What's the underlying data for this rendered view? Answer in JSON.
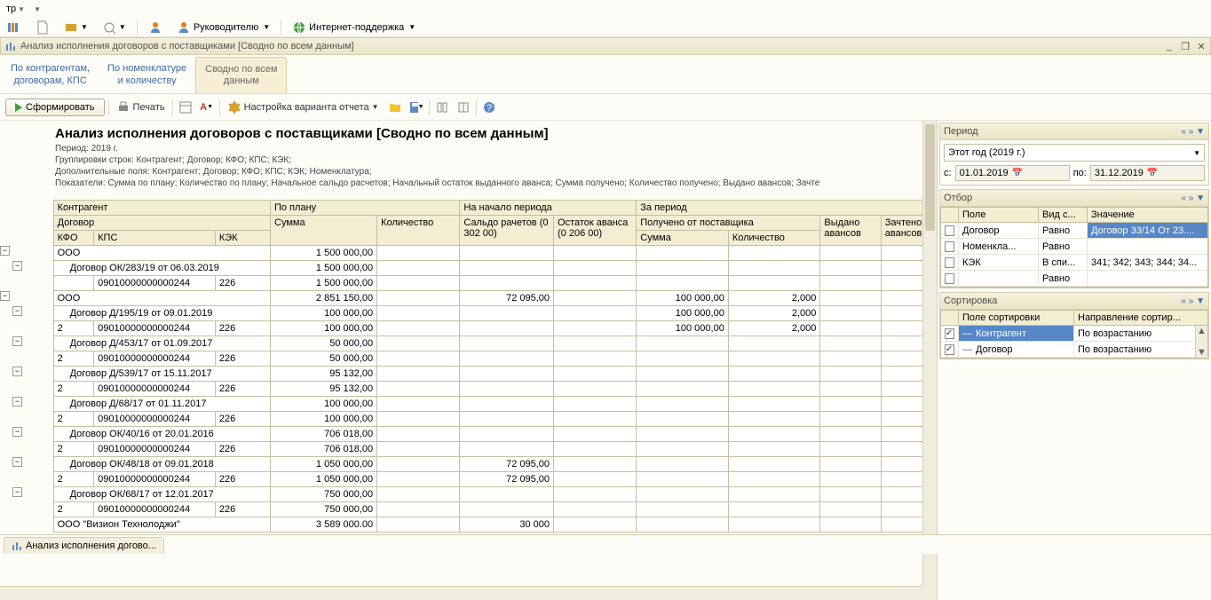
{
  "topbar": {
    "rukov": "Руководителю",
    "inet": "Интернет-поддержка"
  },
  "window": {
    "title": "Анализ исполнения договоров с поставщиками [Сводно по всем данным]"
  },
  "main_tabs": [
    {
      "label": "По контрагентам,\nдоговорам, КПС"
    },
    {
      "label": "По номенклатуре\nи количеству"
    },
    {
      "label": "Сводно по всем\nданным"
    }
  ],
  "report_tb": {
    "form": "Сформировать",
    "print": "Печать",
    "settings": "Настройка варианта отчета"
  },
  "report_header": {
    "title": "Анализ исполнения договоров с поставщиками [Сводно по всем данным]",
    "m1": "Период: 2019 г.",
    "m2": "Группировки строк: Контрагент; Договор; КФО; КПС; КЭК;",
    "m3": "Дополнительные поля: Контрагент; Договор; КФО; КПС; КЭК; Номенклатура;",
    "m4": "Показатели: Сумма по плану; Количество по плану; Начальное сальдо расчетов; Начальный остаток выданного аванса; Сумма получено; Количество получено; Выдано авансов; Зачте"
  },
  "cols": {
    "c1": "Контрагент",
    "c2": "По плану",
    "c3": "На начало периода",
    "c4": "За период",
    "d1": "Договор",
    "d2": "Сумма",
    "d3": "Количество",
    "d4": "Сальдо рачетов (0 302 00)",
    "d5": "Остаток аванса (0 206 00)",
    "d6": "Получено от поставщика",
    "d7": "Выдано авансов",
    "d8": "Зачтено авансов",
    "e1": "КФО",
    "e2": "КПС",
    "e3": "КЭК",
    "e4": "Сумма",
    "e5": "Количество"
  },
  "rows": [
    {
      "lvl": 0,
      "tree": "-",
      "c": "ООО",
      "p": "1 500 000,00"
    },
    {
      "lvl": 1,
      "tree": "-",
      "c": "Договор ОК/283/19 от 06.03.2019",
      "p": "1 500 000,00"
    },
    {
      "lvl": 2,
      "tree": "",
      "kfo": "",
      "kps": "09010000000000244",
      "kek": "226",
      "p": "1 500 000,00"
    },
    {
      "lvl": 0,
      "tree": "-",
      "c": "ООО",
      "p": "2 851 150,00",
      "sal": "72 095,00",
      "sum": "100 000,00",
      "kol": "2,000"
    },
    {
      "lvl": 1,
      "tree": "-",
      "c": "Договор Д/195/19 от 09.01.2019",
      "p": "100 000,00",
      "sum": "100 000,00",
      "kol": "2,000"
    },
    {
      "lvl": 2,
      "tree": "",
      "kfo": "2",
      "kps": "09010000000000244",
      "kek": "226",
      "p": "100 000,00",
      "sum": "100 000,00",
      "kol": "2,000"
    },
    {
      "lvl": 1,
      "tree": "-",
      "c": "Договор Д/453/17 от 01.09.2017",
      "p": "50 000,00"
    },
    {
      "lvl": 2,
      "tree": "",
      "kfo": "2",
      "kps": "09010000000000244",
      "kek": "226",
      "p": "50 000,00"
    },
    {
      "lvl": 1,
      "tree": "-",
      "c": "Договор Д/539/17 от 15.11.2017",
      "p": "95 132,00"
    },
    {
      "lvl": 2,
      "tree": "",
      "kfo": "2",
      "kps": "09010000000000244",
      "kek": "226",
      "p": "95 132,00"
    },
    {
      "lvl": 1,
      "tree": "-",
      "c": "Договор Д/68/17 от 01.11.2017",
      "p": "100 000,00"
    },
    {
      "lvl": 2,
      "tree": "",
      "kfo": "2",
      "kps": "09010000000000244",
      "kek": "226",
      "p": "100 000,00"
    },
    {
      "lvl": 1,
      "tree": "-",
      "c": "Договор ОК/40/16 от 20.01.2016",
      "p": "706 018,00"
    },
    {
      "lvl": 2,
      "tree": "",
      "kfo": "2",
      "kps": "09010000000000244",
      "kek": "226",
      "p": "706 018,00"
    },
    {
      "lvl": 1,
      "tree": "-",
      "c": "Договор ОК/48/18 от 09.01.2018",
      "p": "1 050 000,00",
      "sal": "72 095,00"
    },
    {
      "lvl": 2,
      "tree": "",
      "kfo": "2",
      "kps": "09010000000000244",
      "kek": "226",
      "p": "1 050 000,00",
      "sal": "72 095,00"
    },
    {
      "lvl": 1,
      "tree": "-",
      "c": "Договор ОК/68/17 от 12.01.2017",
      "p": "750 000,00"
    },
    {
      "lvl": 2,
      "tree": "",
      "kfo": "2",
      "kps": "09010000000000244",
      "kek": "226",
      "p": "750 000,00"
    },
    {
      "lvl": 0,
      "tree": "",
      "c": "ООО \"Визион Технолоджи\"",
      "p": "3 589 000.00",
      "sal": "30 000"
    }
  ],
  "period_panel": {
    "title": "Период",
    "select": "Этот год (2019 г.)",
    "from_lbl": "с:",
    "from": "01.01.2019",
    "to_lbl": "по:",
    "to": "31.12.2019"
  },
  "filter_panel": {
    "title": "Отбор",
    "h1": "Поле",
    "h2": "Вид с...",
    "h3": "Значение",
    "rows": [
      {
        "chk": false,
        "f": "Договор",
        "op": "Равно",
        "v": "Договор 33/14 От 23....",
        "sel": true
      },
      {
        "chk": false,
        "f": "Номенкла...",
        "op": "Равно",
        "v": ""
      },
      {
        "chk": false,
        "f": "КЭК",
        "op": "В спи...",
        "v": "341; 342; 343; 344; 34..."
      },
      {
        "chk": false,
        "f": "",
        "op": "Равно",
        "v": ""
      }
    ]
  },
  "sort_panel": {
    "title": "Сортировка",
    "h1": "Поле сортировки",
    "h2": "Направление сортир...",
    "rows": [
      {
        "chk": true,
        "f": "Контрагент",
        "d": "По возрастанию",
        "sel": true
      },
      {
        "chk": true,
        "f": "Договор",
        "d": "По возрастанию"
      }
    ]
  },
  "bottom_tab": "Анализ исполнения догово..."
}
